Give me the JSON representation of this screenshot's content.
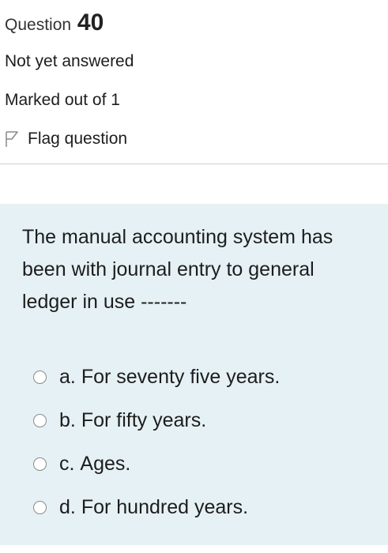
{
  "info": {
    "question_word": "Question",
    "question_number": "40",
    "state": "Not yet answered",
    "grade": "Marked out of 1",
    "flag_label": "Flag question"
  },
  "question": {
    "text": "The manual accounting system has been with journal entry to general ledger in use -------",
    "options": [
      {
        "letter": "a.",
        "text": "For seventy five years."
      },
      {
        "letter": "b.",
        "text": "For fifty years."
      },
      {
        "letter": "c.",
        "text": "Ages."
      },
      {
        "letter": "d.",
        "text": "For hundred years."
      }
    ]
  },
  "colors": {
    "content_background": "#e6f1f5",
    "divider": "#cfcfcf"
  },
  "icons": {
    "flag": "flag-icon",
    "radio": "radio-unselected"
  }
}
